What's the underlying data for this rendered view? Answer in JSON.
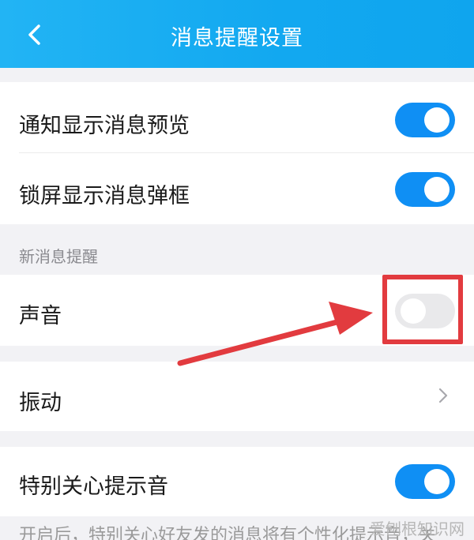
{
  "header": {
    "title": "消息提醒设置",
    "back_icon": "chevron-left-icon"
  },
  "settings": {
    "notification_preview": {
      "label": "通知显示消息预览",
      "enabled": true
    },
    "lockscreen_popup": {
      "label": "锁屏显示消息弹框",
      "enabled": true
    }
  },
  "new_message_section": {
    "header": "新消息提醒",
    "sound": {
      "label": "声音",
      "enabled": false
    },
    "vibration": {
      "label": "振动",
      "icon": "chevron-right-icon"
    }
  },
  "special_care": {
    "label": "特别关心提示音",
    "enabled": true
  },
  "footer_text": "开启后，特别关心好友发的消息将有个性化提示音，关",
  "watermark": "爱刨根知识网",
  "colors": {
    "header": "#1aaef2",
    "toggle_on": "#0f8ff4",
    "toggle_off": "#e9e9eb",
    "annotation": "#e23b3f"
  }
}
